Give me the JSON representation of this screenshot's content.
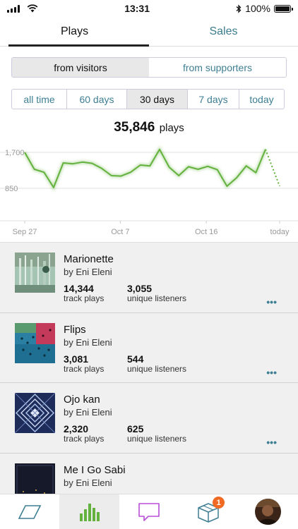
{
  "status_bar": {
    "time": "13:31",
    "battery": "100%"
  },
  "tabs": [
    {
      "label": "Plays",
      "active": true
    },
    {
      "label": "Sales",
      "active": false
    }
  ],
  "source_filter": [
    {
      "label": "from visitors",
      "active": true
    },
    {
      "label": "from supporters",
      "active": false
    }
  ],
  "range_filter": [
    {
      "label": "all time",
      "active": false
    },
    {
      "label": "60 days",
      "active": false
    },
    {
      "label": "30 days",
      "active": true
    },
    {
      "label": "7 days",
      "active": false
    },
    {
      "label": "today",
      "active": false
    }
  ],
  "total": {
    "value": "35,846",
    "unit": "plays"
  },
  "chart_data": {
    "type": "line",
    "y_tick_labels": [
      "1,700",
      "850"
    ],
    "x_tick_labels": [
      "Sep 27",
      "Oct 7",
      "Oct 16",
      "today"
    ],
    "ylim": [
      0,
      2000
    ],
    "values": [
      1700,
      1300,
      1230,
      870,
      1450,
      1430,
      1470,
      1440,
      1320,
      1150,
      1140,
      1230,
      1400,
      1380,
      1770,
      1350,
      1150,
      1360,
      1300,
      1370,
      1290,
      900,
      1100,
      1380,
      1220,
      1770
    ],
    "today_value": 900,
    "line_color": "#63b23d",
    "grid": true
  },
  "tracks": [
    {
      "title": "Marionette",
      "artist": "by Eni Eleni",
      "plays": "14,344",
      "plays_label": "track plays",
      "listeners": "3,055",
      "listeners_label": "unique listeners",
      "more": "•••"
    },
    {
      "title": "Flips",
      "artist": "by Eni Eleni",
      "plays": "3,081",
      "plays_label": "track plays",
      "listeners": "544",
      "listeners_label": "unique listeners",
      "more": "•••"
    },
    {
      "title": "Ojo kan",
      "artist": "by Eni Eleni",
      "plays": "2,320",
      "plays_label": "track plays",
      "listeners": "625",
      "listeners_label": "unique listeners",
      "more": "•••"
    },
    {
      "title": "Me I Go Sabi",
      "artist": "by Eni Eleni"
    }
  ],
  "bottom_nav": [
    {
      "icon": "feed-icon",
      "active": false
    },
    {
      "icon": "stats-icon",
      "active": true
    },
    {
      "icon": "messages-icon",
      "active": false
    },
    {
      "icon": "orders-icon",
      "active": false,
      "badge": "1"
    },
    {
      "icon": "profile-avatar",
      "active": false
    }
  ],
  "colors": {
    "accent": "#3e7f93",
    "chart_line": "#63b23d",
    "badge": "#f06a24",
    "stats_icon": "#63b23d",
    "messages_icon": "#b84fd6"
  }
}
